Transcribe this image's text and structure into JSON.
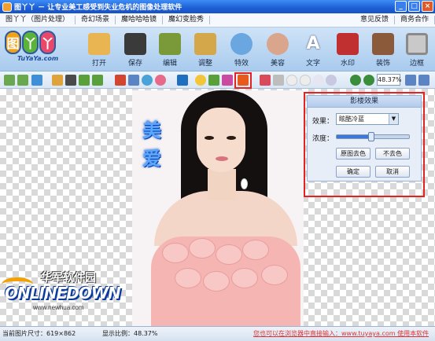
{
  "window": {
    "title": "图丫丫 － 让专业美工感受到失业危机的图像处理软件",
    "controls": {
      "minimize": "_",
      "maximize": "□",
      "close": "×"
    }
  },
  "menu": {
    "left": [
      "图丫丫（图片处理）",
      "奇幻场景",
      "魔哈哈哈镜",
      "魔幻变脸秀"
    ],
    "right": [
      "意见反馈",
      "商务合作"
    ]
  },
  "logo": {
    "letters": [
      "图",
      "丫",
      "丫"
    ],
    "sub": "TuYaYa.com"
  },
  "toolbar": {
    "items": [
      {
        "label": "打开",
        "icon": "folder-open-icon",
        "color": "#e8b552"
      },
      {
        "label": "保存",
        "icon": "floppy-disk-icon",
        "color": "#3a3a3a"
      },
      {
        "label": "编辑",
        "icon": "edit-picture-icon",
        "color": "#7a9a3a"
      },
      {
        "label": "调整",
        "icon": "adjust-frame-icon",
        "color": "#d4a84a"
      },
      {
        "label": "特效",
        "icon": "effects-disc-icon",
        "color": "#6aa7e0"
      },
      {
        "label": "美容",
        "icon": "beauty-face-icon",
        "color": "#d9a58c"
      },
      {
        "label": "文字",
        "icon": "text-letter-icon",
        "color": "#ffffff"
      },
      {
        "label": "水印",
        "icon": "watermark-stamp-icon",
        "color": "#c03030"
      },
      {
        "label": "装饰",
        "icon": "decoration-frame-icon",
        "color": "#8a5a3a"
      },
      {
        "label": "边框",
        "icon": "border-frame-icon",
        "color": "#c9c9c9"
      }
    ]
  },
  "small_toolbar": {
    "zoom_value": "48.37%"
  },
  "panel": {
    "title": "影楼效果",
    "effect_label": "效果：",
    "effect_value": "眩酷冷蓝",
    "intensity_label": "浓度：",
    "intensity_level": 0.48,
    "btn_restore": "原图去色",
    "btn_no_desat": "不去色",
    "btn_ok": "确定",
    "btn_cancel": "取消"
  },
  "canvas": {
    "photo_text": [
      "美",
      "爱"
    ]
  },
  "watermark": {
    "cn": "华军软件园",
    "logo": "ONLINEDOWN",
    "url": "www.newhua.com"
  },
  "status": {
    "size_label": "当前图片尺寸：619×862",
    "scale_label": "显示比例：48.37%",
    "tip": "您也可以在浏览器中直接输入：www.tuyaya.com 使用本软件"
  }
}
